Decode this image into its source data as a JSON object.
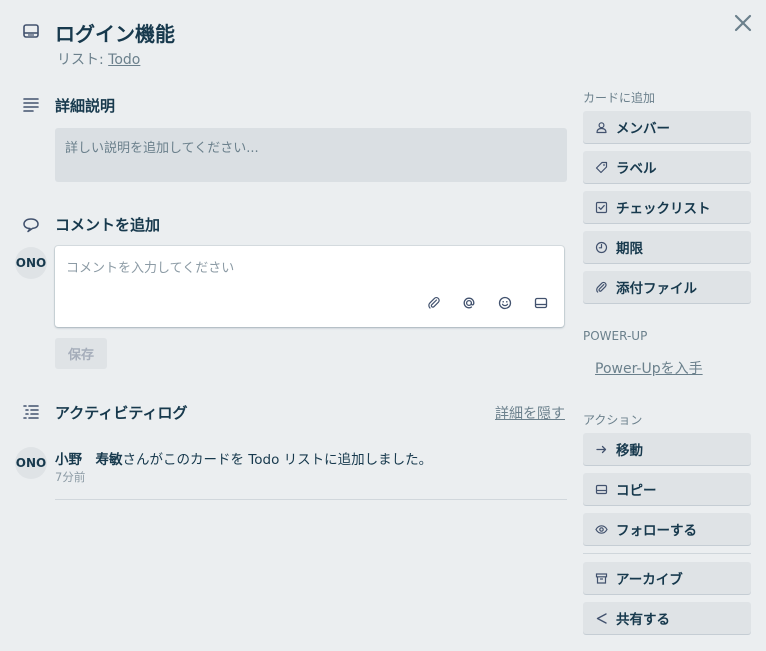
{
  "card": {
    "title": "ログイン機能",
    "list_prefix": "リスト: ",
    "list_name": "Todo"
  },
  "description": {
    "heading": "詳細説明",
    "placeholder": "詳しい説明を追加してください..."
  },
  "comment": {
    "heading": "コメントを追加",
    "avatar": "ONO",
    "placeholder": "コメントを入力してください",
    "save_label": "保存"
  },
  "activity": {
    "heading": "アクティビティログ",
    "hide_details": "詳細を隠す",
    "entries": [
      {
        "avatar": "ONO",
        "user": "小野　寿敏",
        "text": "さんがこのカードを Todo リストに追加しました。",
        "time": "7分前"
      }
    ]
  },
  "sidebar": {
    "add_to_card_heading": "カードに追加",
    "add_buttons": [
      {
        "label": "メンバー",
        "icon": "person-icon"
      },
      {
        "label": "ラベル",
        "icon": "tag-icon"
      },
      {
        "label": "チェックリスト",
        "icon": "checkbox-icon"
      },
      {
        "label": "期限",
        "icon": "clock-icon"
      },
      {
        "label": "添付ファイル",
        "icon": "paperclip-icon"
      }
    ],
    "powerup_heading": "POWER-UP",
    "powerup_link": "Power-Upを入手",
    "actions_heading": "アクション",
    "action_buttons": [
      {
        "label": "移動",
        "icon": "arrow-right-icon"
      },
      {
        "label": "コピー",
        "icon": "card-icon"
      },
      {
        "label": "フォローする",
        "icon": "eye-icon"
      }
    ],
    "extra_buttons": [
      {
        "label": "アーカイブ",
        "icon": "archive-icon"
      },
      {
        "label": "共有する",
        "icon": "share-icon"
      }
    ]
  },
  "colors": {
    "background": "#ebeef0",
    "text": "#17394d",
    "muted": "#6b808c",
    "button": "#dfe3e6"
  }
}
